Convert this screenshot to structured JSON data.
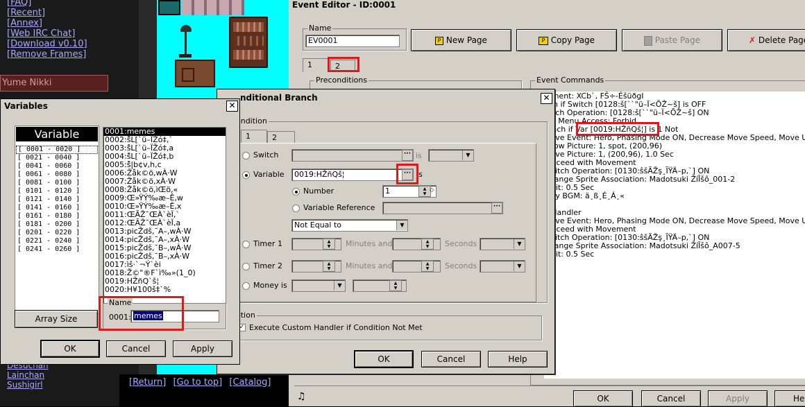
{
  "colors": {
    "accent": "#e0171b",
    "link": "#a8a8ff",
    "window": "#d4d0c8",
    "tileset_bg": "#00ffff"
  },
  "site_nav": {
    "links": [
      "[FAQ]",
      "[Recent]",
      "[Annex]",
      "[Web IRC Chat]",
      "[Download v0.10]",
      "[Remove Frames]"
    ],
    "board_label": "Yume Nikki",
    "bottom_links": [
      "Desuchan",
      "Lainchan",
      "Sushigirl"
    ],
    "footer_links": [
      "[Return]",
      "[Go to top]",
      "[Catalog]"
    ]
  },
  "event_editor": {
    "title": "Event Editor - ID:0001",
    "name_label": "Name",
    "name_value": "EV0001",
    "buttons": {
      "new_page": "New Page",
      "copy_page": "Copy Page",
      "paste_page": "Paste Page",
      "delete_page": "Delete Page"
    },
    "tabs": [
      "1",
      "2"
    ],
    "preconditions_label": "Preconditions",
    "commands_label": "Event Commands",
    "commands": [
      "mment: XCb`, FŠ÷-ÉšüðgI",
      "nch if  Switch [0128:š[``\"ü–Ï<ÕŽ~š] is OFF",
      "witch Operation: [0128:š[``\"ü–Ï<ÕŽ~š] ON",
      "ain Menu Access: Forbid",
      "ranch if Var [0019:HŽñQš¦] is 1 Not",
      "Move Event: Hero, Phasing Mode ON, Decrease Move Speed, Move Up",
      "Show Picture: 1, spot, (200,96)",
      "Move Picture: 1, (200,96), 1.0 Sec",
      "Proceed with Movement",
      "Switch Operation: [0130:ŝšÃŽş¸ĨŸÄ–p,`] ON",
      "Change Sprite Association: Madotsuki ŽíÎšô_001-2",
      "Wait: 0.5 Sec",
      "Play BGM: ä¸ß¸É¸Á¸«",
      "",
      "e Handler",
      "Move Event: Hero, Phasing Mode ON, Decrease Move Speed, Move Up",
      "Proceed with Movement",
      "Switch Operation: [0130:ŝšÃŽş¸ĨŸÄ–p,`] ON",
      "Change Sprite Association: Madotsuki ŽíÎšô_A007-5",
      "Wait: 0.5 Sec",
      "",
      "d"
    ],
    "bottom_buttons": {
      "ok": "OK",
      "cancel": "Cancel",
      "apply": "Apply",
      "help": "He"
    }
  },
  "conditional_branch": {
    "title": "nditional Branch",
    "condition_label": "ondition",
    "tabs": [
      "1",
      "2"
    ],
    "switch_label": "Switch",
    "is_label": "is",
    "variable_label": "Variable",
    "variable_value": "0019:HŽñQš¦",
    "is_label_2": "s",
    "number_label": "Number",
    "number_value": "1",
    "variable_reference_label": "Variable Reference",
    "comparison_value": "Not Equal to",
    "timer1_label": "Timer 1",
    "timer2_label": "Timer 2",
    "minutes_and_label": "Minutes and",
    "seconds_label": "Seconds",
    "money_label": "Money is",
    "option_label": "otion",
    "custom_handler_label": "Execute Custom Handler if Condition Not Met",
    "buttons": {
      "ok": "OK",
      "cancel": "Cancel",
      "help": "Help"
    }
  },
  "variables": {
    "title": "Variables",
    "list_header": "Variable",
    "ranges": [
      "[ 0001 - 0020 ]",
      "[ 0021 - 0040 ]",
      "[ 0041 - 0060 ]",
      "[ 0061 - 0080 ]",
      "[ 0081 - 0100 ]",
      "[ 0101 - 0120 ]",
      "[ 0121 - 0140 ]",
      "[ 0141 - 0160 ]",
      "[ 0161 - 0180 ]",
      "[ 0181 - 0200 ]",
      "[ 0201 - 0220 ]",
      "[ 0221 - 0240 ]",
      "[ 0241 - 0260 ]"
    ],
    "items": [
      "0001:memes",
      "0002:ŝ̃L[`ü–ÏŽó‡,`",
      "0003:ŝ̃L[`ü–ÏŽó‡,a",
      "0004:ŝ̃L[`ü–ÏŽó‡,b",
      "0005:ŝ̃|b¢v,h,c",
      "0006:Žåk©ö,wÀ·W",
      "0007:Žåk©ö,xÀ·W",
      "0008:Žåk©ö,ìŒö,«",
      "0009:Œ»ŸÝ‰æ–Ê,w",
      "0010:Œ»ŸÝ‰æ–Ê,x",
      "0011:ŒÃŽ¯ŒÀ`èÏ,`",
      "0012:ŒÃŽ¯ŒÀ`èÏ,a",
      "0013:picŽdš,¯A–,wÀ·W",
      "0014:picŽdš,¯A–,xÀ·W",
      "0015:picŽdš,¯B–,wÀ·W",
      "0016:picŽdš,¯B–,xÀ·W",
      "0017:ìš·`¬Ý`èi",
      "0018:Ž©\"®F`ì‰»(1_0)",
      "0019:HŽñQ`š¦",
      "0020:H¥100š‡`%"
    ],
    "array_size_label": "Array Size",
    "name_label": "Name",
    "id_label": "0001:",
    "name_value": "memes",
    "buttons": {
      "ok": "OK",
      "cancel": "Cancel",
      "apply": "Apply"
    }
  }
}
